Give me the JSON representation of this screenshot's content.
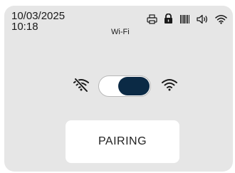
{
  "status_bar": {
    "date": "10/03/2025",
    "time": "10:18",
    "icons": [
      "print-icon",
      "lock-icon",
      "barcode-icon",
      "speaker-icon",
      "wifi-icon"
    ]
  },
  "screen": {
    "title": "Wi-Fi"
  },
  "wifi_toggle": {
    "off_icon": "wifi-off-icon",
    "on_icon": "wifi-on-icon",
    "state": "on"
  },
  "pairing": {
    "label": "PAIRING"
  },
  "colors": {
    "background": "#e6e6e6",
    "accent": "#0b2a45",
    "button": "#ffffff"
  }
}
